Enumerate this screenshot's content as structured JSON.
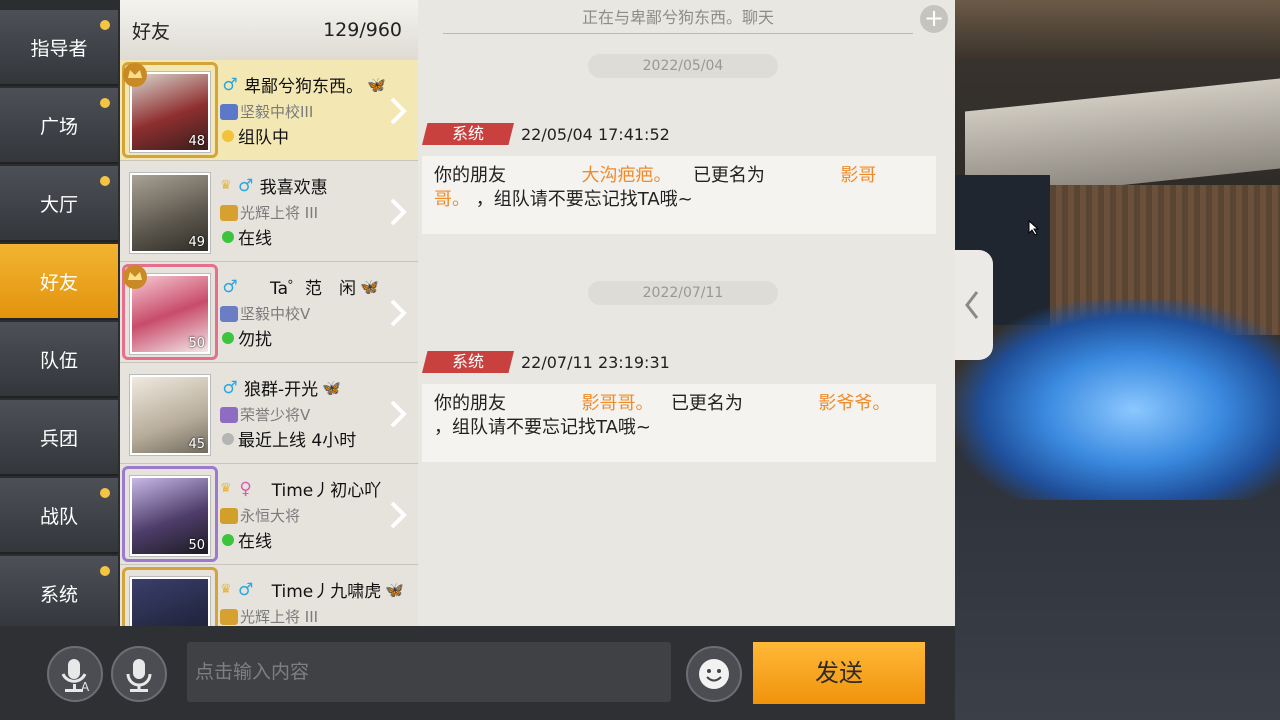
{
  "sidebar": {
    "items": [
      {
        "label": "指导者",
        "dot": true
      },
      {
        "label": "广场",
        "dot": true
      },
      {
        "label": "大厅",
        "dot": true
      },
      {
        "label": "好友",
        "dot": false,
        "active": true
      },
      {
        "label": "队伍",
        "dot": false
      },
      {
        "label": "兵团",
        "dot": false
      },
      {
        "label": "战队",
        "dot": true
      },
      {
        "label": "系统",
        "dot": true
      }
    ]
  },
  "friends": {
    "title": "好友",
    "count": "129/960",
    "rows": [
      {
        "name": "卑鄙兮狗东西。",
        "gender": "male",
        "rank": "坚毅中校III",
        "status": "组队中",
        "level": "48"
      },
      {
        "name": "我喜欢惠",
        "gender": "male",
        "rank": "光辉上将 III",
        "status": "在线",
        "level": "49"
      },
      {
        "name": "Ta゜范　闲",
        "gender": "male",
        "rank": "坚毅中校V",
        "status": "勿扰",
        "level": "50"
      },
      {
        "name": "狼群-开光",
        "gender": "male",
        "rank": "荣誉少将V",
        "status": "最近上线 4小时",
        "level": "45"
      },
      {
        "name": "Time丿初心吖",
        "gender": "female",
        "rank": "永恒大将",
        "status": "在线",
        "level": "50"
      },
      {
        "name": "Time丿九啸虎",
        "gender": "male",
        "rank": "光辉上将 III",
        "status": "",
        "level": ""
      }
    ]
  },
  "chat": {
    "title": "正在与卑鄙兮狗东西。聊天",
    "messages": [
      {
        "date": "2022/05/04",
        "tag": "系统",
        "time": "22/05/04 17:41:52",
        "prefix": "你的朋友",
        "old": "大沟疤疤。",
        "mid": "已更名为",
        "new1": "影哥",
        "new2": "哥。",
        "suffix": "，组队请不要忘记找TA哦~"
      },
      {
        "date": "2022/07/11",
        "tag": "系统",
        "time": "22/07/11 23:19:31",
        "prefix": "你的朋友",
        "old": "影哥哥。",
        "mid": "已更名为",
        "new1": "影爷爷。",
        "new2": "",
        "suffix": "，组队请不要忘记找TA哦~"
      }
    ]
  },
  "input": {
    "placeholder": "点击输入内容"
  },
  "send_label": "发送",
  "icons": {
    "voice_to_text": "mic-text-icon",
    "voice": "mic-icon",
    "emoji": "emoji-icon",
    "add": "plus-icon",
    "expand": "chevron-left-icon"
  },
  "colors": {
    "accent": "#f0930c",
    "system_tag": "#c9413f",
    "highlight": "#f08b2c",
    "online": "#3cc43c",
    "team": "#f2c23a",
    "offline": "#b5b5b5"
  }
}
